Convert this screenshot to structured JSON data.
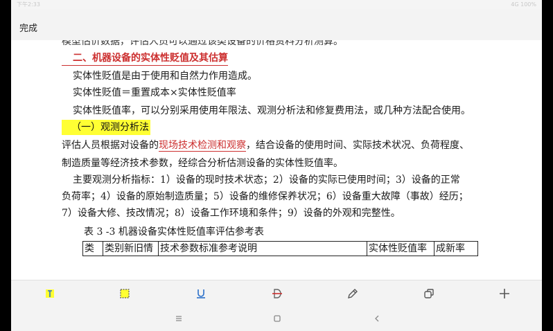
{
  "status_bar": {
    "time": "下午2:33",
    "right": "4G 100%"
  },
  "topbar": {
    "done_label": "完成"
  },
  "document": {
    "clipped_line": "模型估价数据，评估人员可以通过该类设备的价格资料分析测算。",
    "heading2": "二、机器设备的实体性贬值及其估算",
    "para1": "实体性贬值是由于使用和自然力作用造成。",
    "para2": "实体性贬值＝重置成本×实体性贬值率",
    "para3": "实体性贬值率，可以分别采用使用年限法、观测分析法和修复费用法，或几种方法配合使用。",
    "heading3": "（一）观测分析法",
    "para4_prefix": "评估人员根据对设备的",
    "para4_highlight": "现场技术检测和观察",
    "para4_suffix": "，结合设备的使用时间、实际技术状况、负荷程度、",
    "para5": "制造质量等经济技术参数，经综合分析估测设备的实体性贬值率。",
    "para6": "主要观测分析指标：1）设备的现时技术状态；2）设备的实际已使用时间；3）设备的正常",
    "para7": "负荷率；4）设备的原始制造质量；5）设备的维修保养状况；6）设备重大故障（事故）经历；",
    "para8": "7）设备大修、技改情况；8）设备工作环境和条件；9）设备的外观和完整性。",
    "table_caption": "表 3 -3    机器设备实体性贬值率评估参考表",
    "table_headers": [
      "类",
      "类别新旧情",
      "技术参数标准参考说明",
      "实体性贬值率",
      "成新率"
    ]
  },
  "colors": {
    "highlight": "#ffff33",
    "accent_red": "#cc2f2f",
    "icon_blue": "#2a6fc9"
  },
  "toolbar": {
    "tools": [
      "text-highlight-icon",
      "area-select-icon",
      "underline-icon",
      "strikethrough-icon",
      "pencil-icon",
      "copy-icon",
      "add-icon"
    ]
  },
  "navbar": {
    "buttons": [
      "menu-icon",
      "home-icon",
      "back-icon"
    ]
  }
}
